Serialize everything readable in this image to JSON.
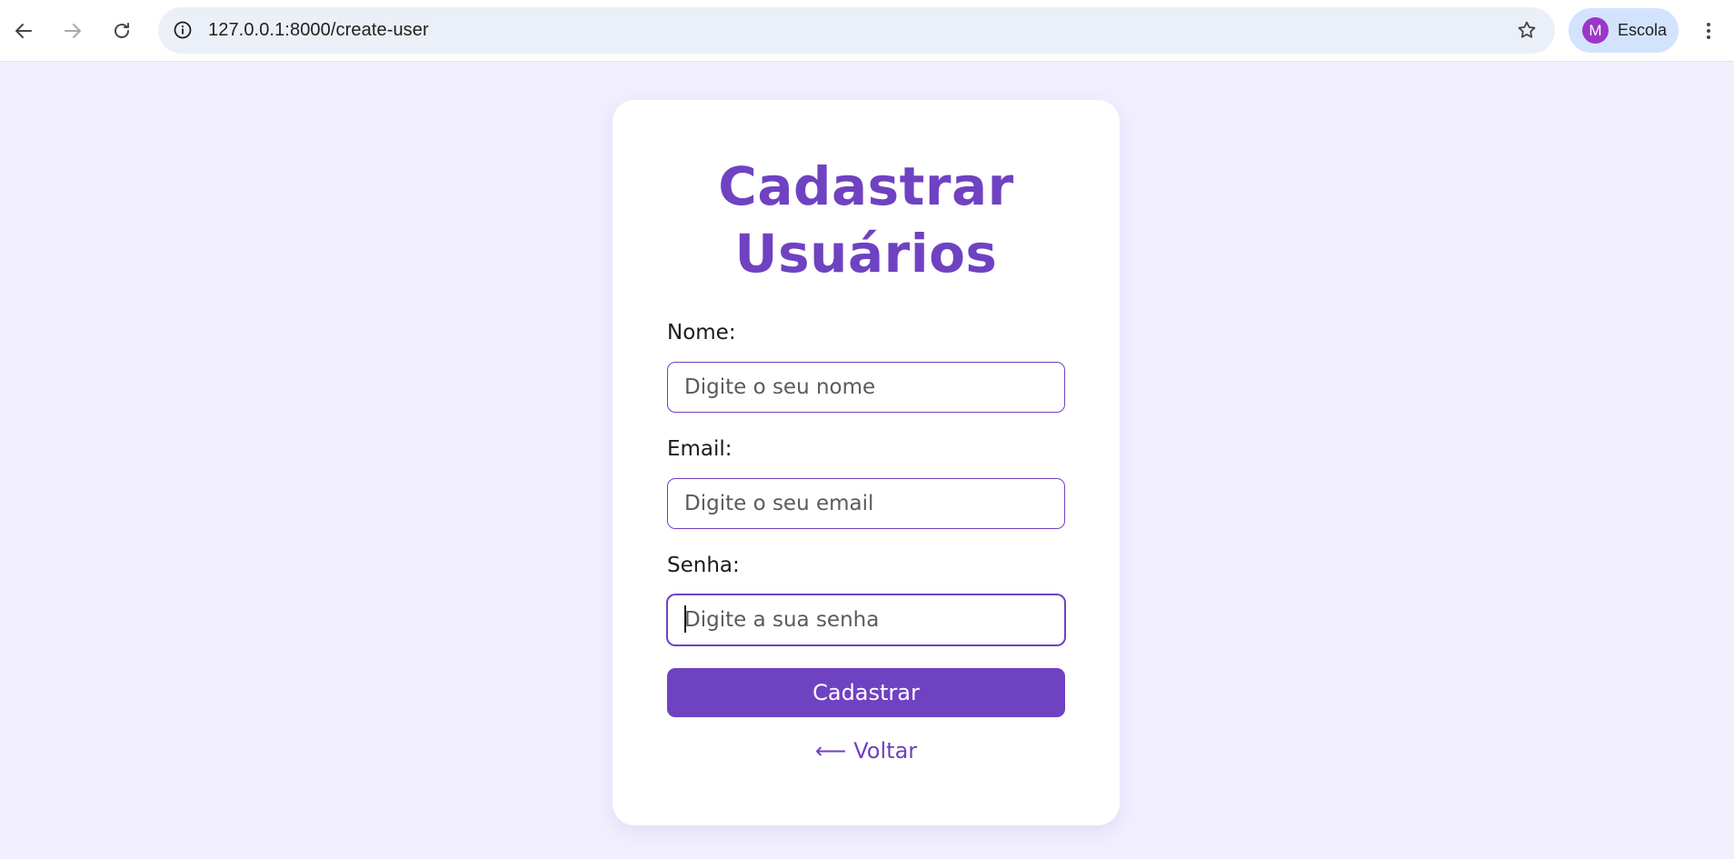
{
  "browser": {
    "url": "127.0.0.1:8000/create-user",
    "profile": {
      "initial": "M",
      "name": "Escola"
    },
    "icons": {
      "back": "back-arrow-icon",
      "forward": "forward-arrow-icon",
      "reload": "reload-icon",
      "site_info": "info-icon",
      "bookmark": "star-icon",
      "menu": "kebab-menu-icon"
    }
  },
  "form": {
    "title_line1": "Cadastrar",
    "title_line2": "Usuários",
    "name_label": "Nome:",
    "name_placeholder": "Digite o seu nome",
    "email_label": "Email:",
    "email_placeholder": "Digite o seu email",
    "password_label": "Senha:",
    "password_placeholder": "Digite a sua senha",
    "submit_label": "Cadastrar",
    "back_arrow": "⟵",
    "back_label": "Voltar"
  },
  "colors": {
    "accent": "#6f42c1",
    "page_background": "#f1eefe",
    "card_background": "#ffffff",
    "avatar": "#9b37c9",
    "profile_chip": "#d3e3fd",
    "omnibox": "#ebeff8"
  }
}
